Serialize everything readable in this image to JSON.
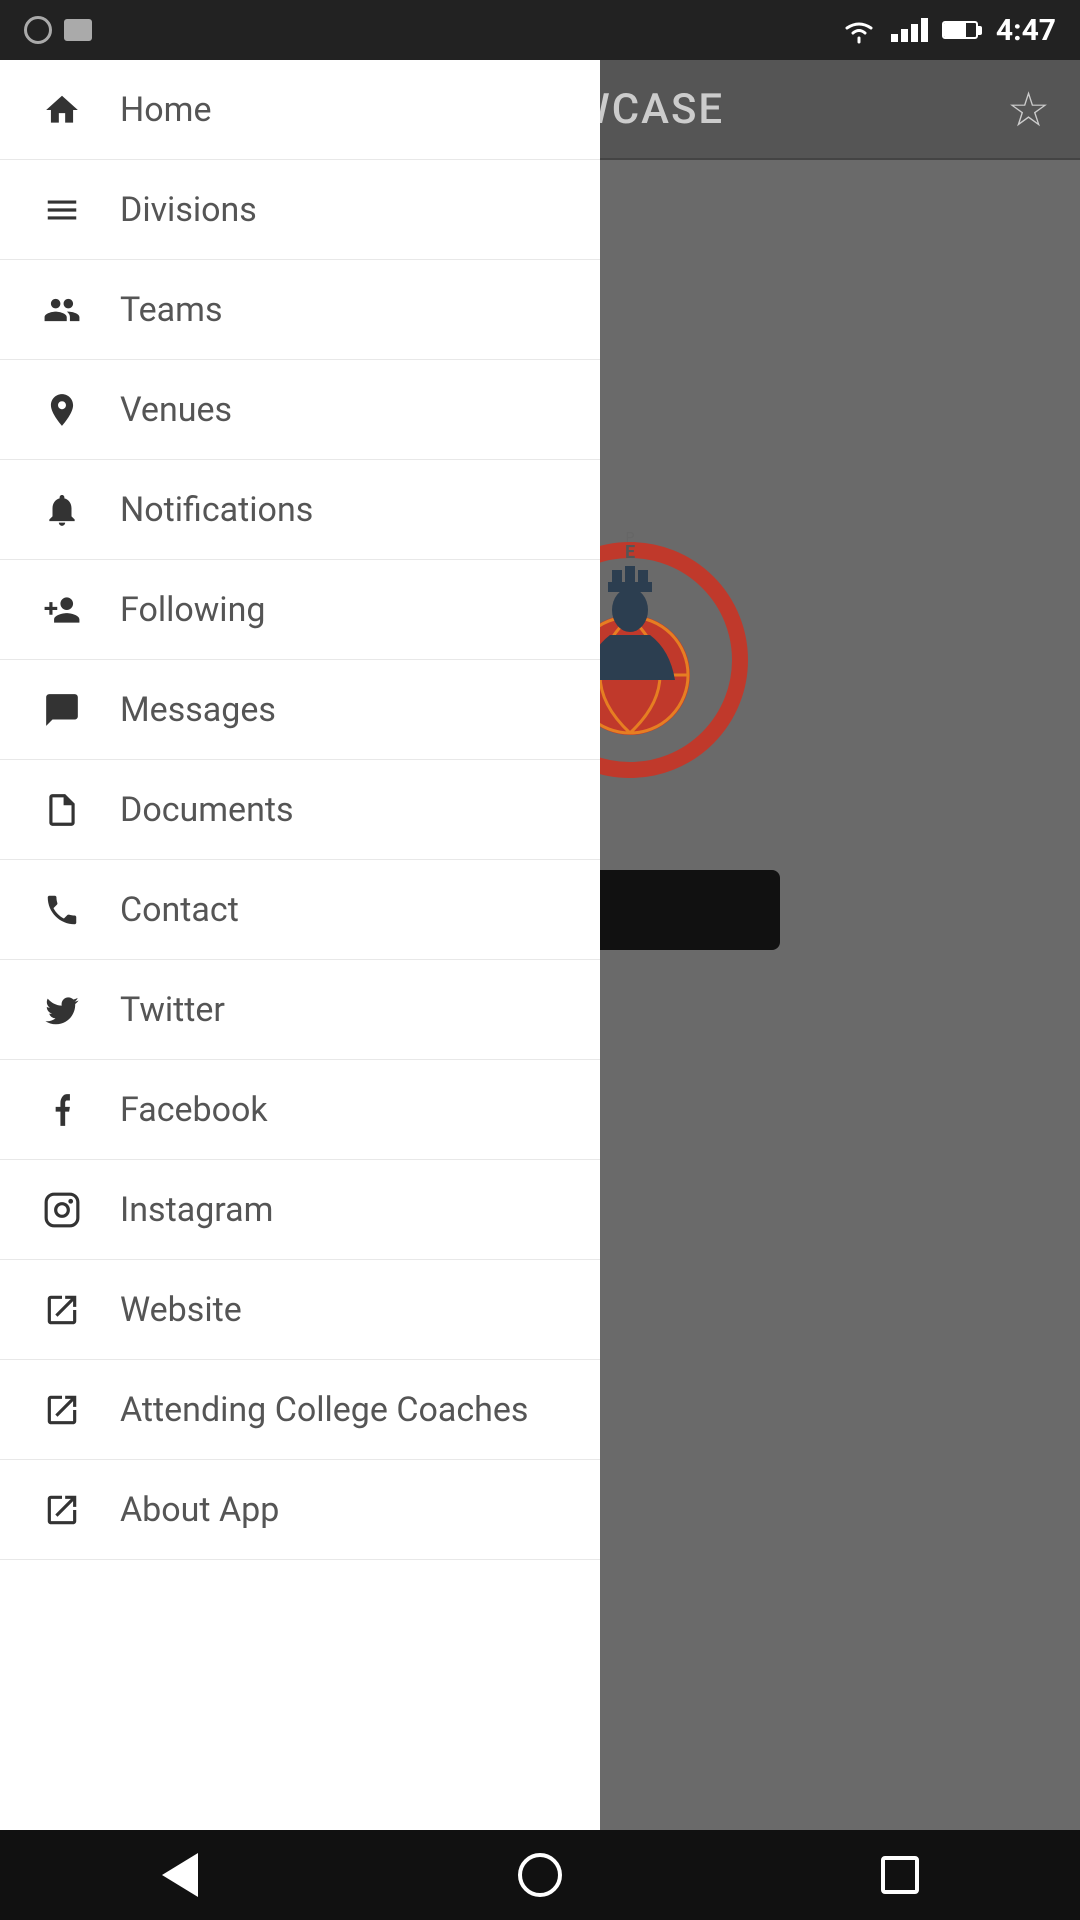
{
  "statusBar": {
    "time": "4:47"
  },
  "header": {
    "title": "HOWCASE",
    "starLabel": "favorite"
  },
  "drawer": {
    "items": [
      {
        "id": "home",
        "label": "Home",
        "icon": "home-icon"
      },
      {
        "id": "divisions",
        "label": "Divisions",
        "icon": "divisions-icon"
      },
      {
        "id": "teams",
        "label": "Teams",
        "icon": "teams-icon"
      },
      {
        "id": "venues",
        "label": "Venues",
        "icon": "venues-icon"
      },
      {
        "id": "notifications",
        "label": "Notifications",
        "icon": "notifications-icon"
      },
      {
        "id": "following",
        "label": "Following",
        "icon": "following-icon"
      },
      {
        "id": "messages",
        "label": "Messages",
        "icon": "messages-icon"
      },
      {
        "id": "documents",
        "label": "Documents",
        "icon": "documents-icon"
      },
      {
        "id": "contact",
        "label": "Contact",
        "icon": "contact-icon"
      },
      {
        "id": "twitter",
        "label": "Twitter",
        "icon": "twitter-icon"
      },
      {
        "id": "facebook",
        "label": "Facebook",
        "icon": "facebook-icon"
      },
      {
        "id": "instagram",
        "label": "Instagram",
        "icon": "instagram-icon"
      },
      {
        "id": "website",
        "label": "Website",
        "icon": "website-icon"
      },
      {
        "id": "attending-college-coaches",
        "label": "Attending College Coaches",
        "icon": "attending-icon"
      },
      {
        "id": "about-app",
        "label": "About App",
        "icon": "about-icon"
      }
    ]
  },
  "bottomNav": {
    "back": "back",
    "home": "home",
    "recent": "recent"
  }
}
